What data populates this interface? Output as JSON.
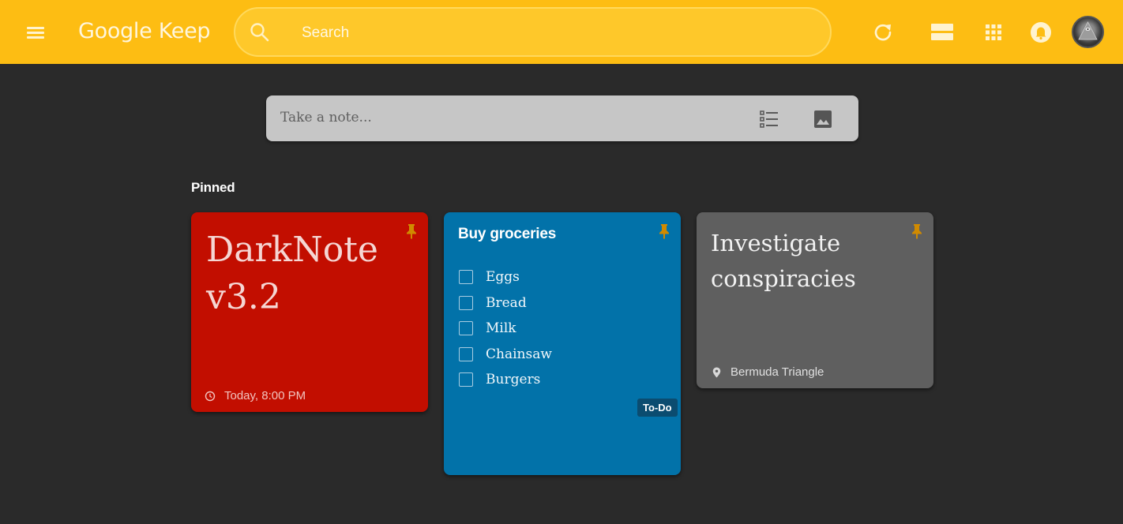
{
  "app": {
    "logo": "Google Keep"
  },
  "search": {
    "placeholder": "Search"
  },
  "header_icons": [
    "menu-icon",
    "search-icon",
    "refresh-icon",
    "list-view-icon",
    "apps-icon",
    "notifications-icon",
    "avatar"
  ],
  "composer": {
    "placeholder": "Take a note..."
  },
  "section": {
    "pinned_label": "Pinned"
  },
  "notes": [
    {
      "title": "DarkNote v3.2",
      "color": "#c20e00",
      "pinned": true,
      "reminder": "Today, 8:00 PM"
    },
    {
      "title": "Buy groceries",
      "color": "#0272a9",
      "pinned": true,
      "items": [
        "Eggs",
        "Bread",
        "Milk",
        "Chainsaw",
        "Burgers"
      ],
      "label": "To-Do"
    },
    {
      "title": "Investigate conspiracies",
      "color": "#5f5f5f",
      "pinned": true,
      "location": "Bermuda Triangle"
    }
  ],
  "colors": {
    "header": "#fdbd13",
    "background": "#2a2a2a",
    "pin": "#d08a00"
  }
}
